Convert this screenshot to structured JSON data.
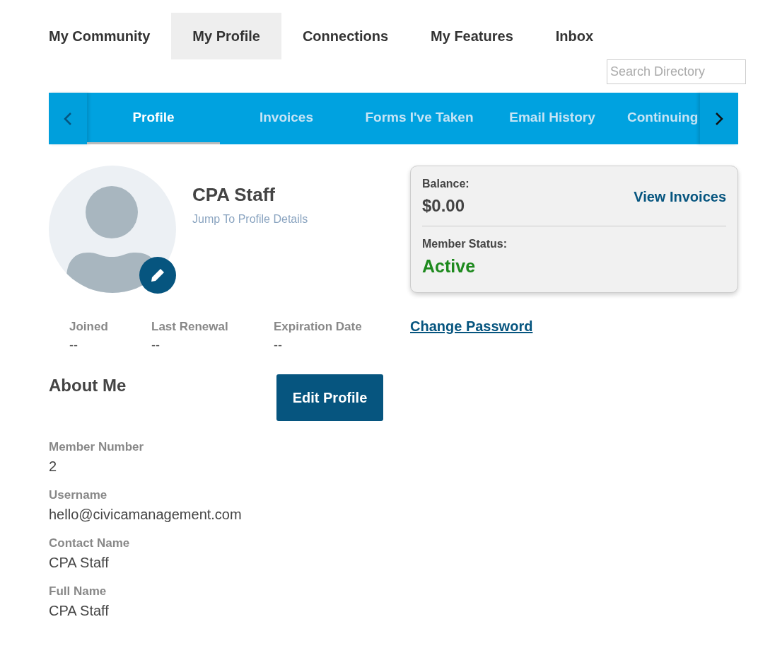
{
  "top_nav": [
    {
      "label": "My Community",
      "selected": false
    },
    {
      "label": "My Profile",
      "selected": true
    },
    {
      "label": "Connections",
      "selected": false
    },
    {
      "label": "My Features",
      "selected": false
    },
    {
      "label": "Inbox",
      "selected": false
    }
  ],
  "search": {
    "placeholder": "Search Directory"
  },
  "sub_tabs": [
    {
      "label": "Profile",
      "selected": true
    },
    {
      "label": "Invoices",
      "selected": false
    },
    {
      "label": "Forms I've Taken",
      "selected": false
    },
    {
      "label": "Email History",
      "selected": false
    },
    {
      "label": "Continuing",
      "selected": false
    }
  ],
  "profile": {
    "name": "CPA Staff",
    "jump_link": "Jump To Profile Details"
  },
  "dates": [
    {
      "label": "Joined",
      "value": "--"
    },
    {
      "label": "Last Renewal",
      "value": "--"
    },
    {
      "label": "Expiration Date",
      "value": "--"
    }
  ],
  "account_card": {
    "balance_label": "Balance:",
    "balance": "$0.00",
    "invoices_link": "View Invoices",
    "status_label": "Member Status:",
    "status": "Active"
  },
  "change_password": "Change Password",
  "about": {
    "title": "About Me",
    "edit_button": "Edit Profile"
  },
  "fields": [
    {
      "label": "Member Number",
      "value": "2"
    },
    {
      "label": "Username",
      "value": "hello@civicamanagement.com"
    },
    {
      "label": "Contact Name",
      "value": "CPA Staff"
    },
    {
      "label": "Full Name",
      "value": "CPA Staff"
    }
  ]
}
